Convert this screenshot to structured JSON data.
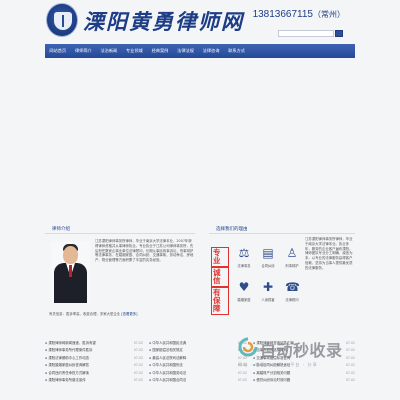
{
  "header": {
    "logo_title": "溧阳黄勇律师网",
    "phone": "13813667115",
    "city": "（常州）"
  },
  "nav": {
    "items": [
      "网站首页",
      "律师简介",
      "法治新闻",
      "专业领域",
      "经典案例",
      "法律法规",
      "法律咨询",
      "联系方式"
    ]
  },
  "intro": {
    "title": "律师介绍",
    "text": "江苏溧阳律师事务所律师，毕业于南京大学法律本业，2007年获得律师资格并从事律师执业。专业执业于江苏公司律师事务所，先后担任数家企事业单位法律顾问，长期从事民商事诉讼、刑事辩护等法律事务，在婚姻家庭、合同纠纷、交通事故、劳动争议、房地产、物业管理等方面积累了丰富的实务经验。",
    "footer": "有关信息：胜诉率高，收费合理，多家大型企业",
    "more": "[查看更多]"
  },
  "reasons": {
    "title": "选择我们的理由",
    "stamps": [
      "专业",
      "诚信",
      "有保障"
    ],
    "icons": [
      {
        "label": "法律事务",
        "icon": "scales-icon"
      },
      {
        "label": "合同纠纷",
        "icon": "document-icon"
      },
      {
        "label": "刑事辩护",
        "icon": "person-icon"
      },
      {
        "label": "婚姻家庭",
        "icon": "family-icon"
      },
      {
        "label": "人身损害",
        "icon": "injury-icon"
      },
      {
        "label": "法律顾问",
        "icon": "advisor-icon"
      }
    ],
    "text": "江苏溧阳律师事务所律师，毕业于南京大学法律本业。执业多年，服务的企业客户遍布溧阳。律师团队专业分工明确，诚信为本，以专业的法律服务赢得客户信赖，坚持为当事人提供最优质的法律服务。"
  },
  "lists": {
    "col1": [
      {
        "text": "溧阳律师网新闻速递，胜诉有望",
        "date": "07-02"
      },
      {
        "text": "溧阳律师事务所代理案件胜诉",
        "date": "07-02"
      },
      {
        "text": "溧阳法律援助中心工作动态",
        "date": "07-02"
      },
      {
        "text": "溧阳婚姻家庭纠纷咨询解答",
        "date": "07-02"
      },
      {
        "text": "合同违约责任承担方式解读",
        "date": "07-02"
      },
      {
        "text": "溧阳律师事务所普法宣传",
        "date": "07-02"
      }
    ],
    "col2": [
      {
        "text": "中华人民共和国民法典",
        "date": "07-02"
      },
      {
        "text": "国家赔偿法相关规定",
        "date": "07-02"
      },
      {
        "text": "最高人民法院司法解释",
        "date": "07-02"
      },
      {
        "text": "中华人民共和国刑法",
        "date": "07-02"
      },
      {
        "text": "中华人民共和国劳动法",
        "date": "07-02"
      },
      {
        "text": "中华人民共和国合同法",
        "date": "07-02"
      }
    ],
    "col3": [
      {
        "text": "溧阳律师网咨询问答汇编",
        "date": "07-02"
      },
      {
        "text": "当事人如何选择律师",
        "date": "07-02"
      },
      {
        "text": "交通事故赔偿标准咨询",
        "date": "07-02"
      },
      {
        "text": "劳动合同纠纷解决途径",
        "date": "07-02"
      },
      {
        "text": "离婚财产分割相关问题",
        "date": "07-02"
      },
      {
        "text": "借贷纠纷诉讼时效问题",
        "date": "07-02"
      }
    ]
  },
  "watermark": {
    "title": "自动秒收录",
    "sub": "网站 · 收录 · 工具 · 平台 · 分享"
  }
}
